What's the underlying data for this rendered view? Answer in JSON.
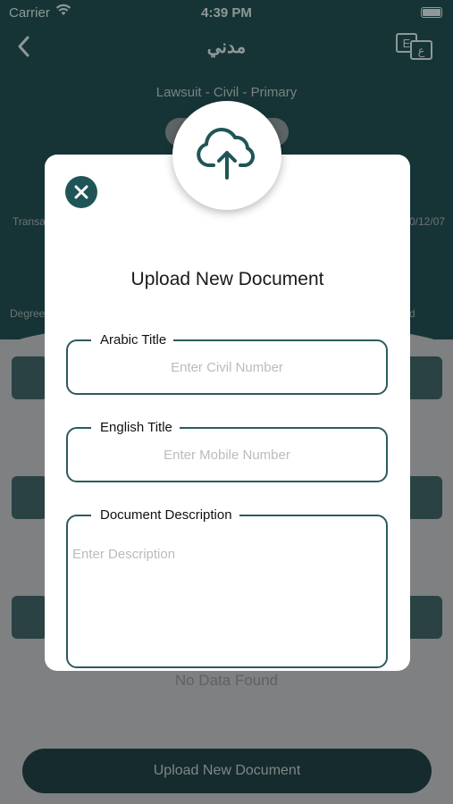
{
  "status_bar": {
    "carrier": "Carrier",
    "time": "4:39 PM"
  },
  "nav": {
    "title": "مدني",
    "back_icon": "chevron-left-icon",
    "language_icon": "language-toggle-icon"
  },
  "case": {
    "subtitle": "Lawsuit - Civil - Primary",
    "left_label_1": "Transa",
    "right_label_1": "0/12/07",
    "left_label_2": "Degree",
    "right_label_2": "d"
  },
  "background": {
    "empty_text": "No Data Found",
    "upload_button_label": "Upload New Document"
  },
  "modal": {
    "title": "Upload New Document",
    "upload_icon": "cloud-upload-icon",
    "close_icon": "close-icon",
    "fields": {
      "arabic_title": {
        "label": "Arabic Title",
        "placeholder": "Enter Civil Number",
        "value": ""
      },
      "english_title": {
        "label": "English Title",
        "placeholder": "Enter Mobile Number",
        "value": ""
      },
      "description": {
        "label": "Document Description",
        "placeholder": "Enter Description",
        "value": ""
      }
    }
  },
  "colors": {
    "primary": "#1f5557",
    "field_border": "#2c5b5d",
    "header_bg": "#163436",
    "overlay_bg": "#7e8081"
  }
}
